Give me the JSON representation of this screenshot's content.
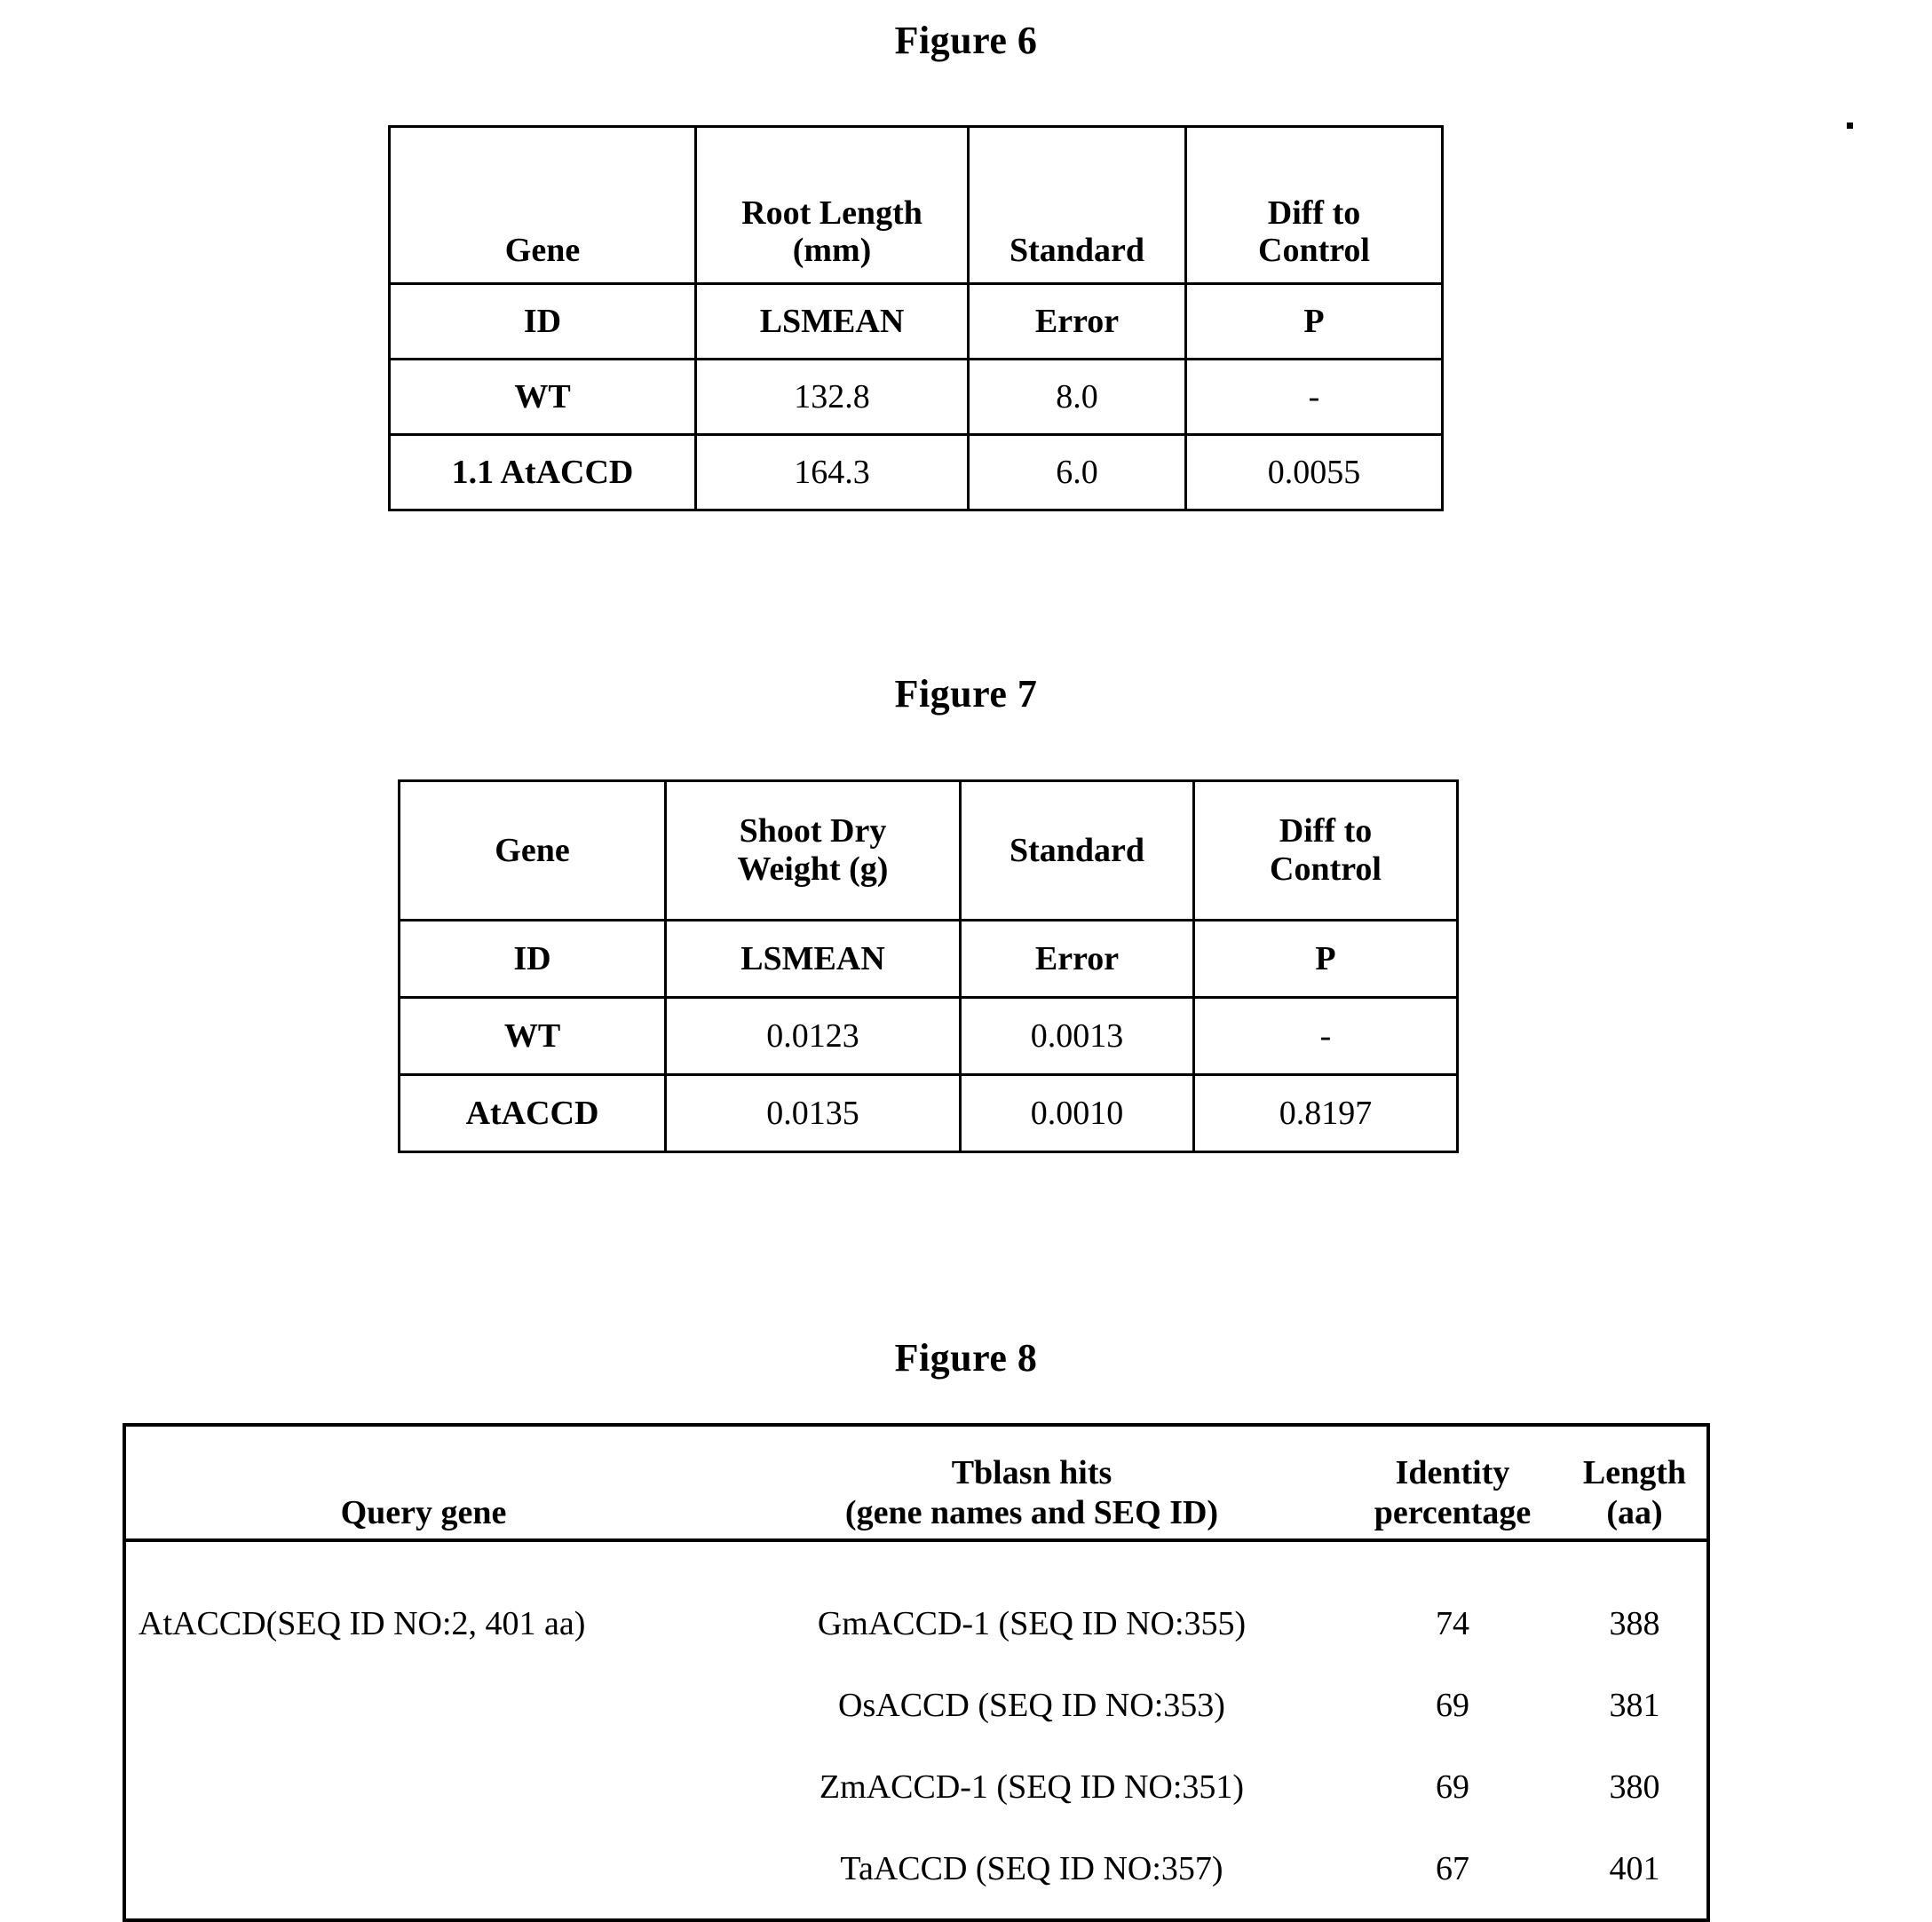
{
  "figures": [
    {
      "title": "Figure 6",
      "table": {
        "header_row_1": [
          "Gene",
          "Root Length\n(mm)",
          "Standard",
          "Diff to\nControl"
        ],
        "header_row_1_lines": [
          [
            "Gene"
          ],
          [
            "Root Length",
            "(mm)"
          ],
          [
            "Standard"
          ],
          [
            "Diff to",
            "Control"
          ]
        ],
        "header_row_2": [
          "ID",
          "LSMEAN",
          "Error",
          "P"
        ],
        "rows": [
          [
            "WT",
            "132.8",
            "8.0",
            "-"
          ],
          [
            "1.1 AtACCD",
            "164.3",
            "6.0",
            "0.0055"
          ]
        ]
      }
    },
    {
      "title": "Figure 7",
      "table": {
        "header_row_1_lines": [
          [
            "Gene"
          ],
          [
            "Shoot Dry",
            "Weight (g)"
          ],
          [
            "Standard"
          ],
          [
            "Diff to",
            "Control"
          ]
        ],
        "header_row_2": [
          "ID",
          "LSMEAN",
          "Error",
          "P"
        ],
        "rows": [
          [
            "WT",
            "0.0123",
            "0.0013",
            "-"
          ],
          [
            "AtACCD",
            "0.0135",
            "0.0010",
            "0.8197"
          ]
        ]
      }
    },
    {
      "title": "Figure 8",
      "table": {
        "header_lines": [
          [
            "Query gene"
          ],
          [
            "Tblasn hits",
            "(gene names and SEQ ID)"
          ],
          [
            "Identity",
            "percentage"
          ],
          [
            "Length",
            "(aa)"
          ]
        ],
        "rows": [
          [
            "AtACCD(SEQ ID NO:2, 401 aa)",
            "GmACCD-1 (SEQ ID NO:355)",
            "74",
            "388"
          ],
          [
            "",
            "OsACCD (SEQ ID NO:353)",
            "69",
            "381"
          ],
          [
            "",
            "ZmACCD-1 (SEQ ID NO:351)",
            "69",
            "380"
          ],
          [
            "",
            "TaACCD (SEQ ID NO:357)",
            "67",
            "401"
          ]
        ]
      }
    }
  ],
  "chart_data": [
    {
      "type": "table",
      "title": "Figure 6",
      "columns": [
        "Gene ID",
        "Root Length (mm) LSMEAN",
        "Standard Error",
        "Diff to Control P"
      ],
      "rows": [
        [
          "WT",
          132.8,
          8.0,
          null
        ],
        [
          "1.1 AtACCD",
          164.3,
          6.0,
          0.0055
        ]
      ]
    },
    {
      "type": "table",
      "title": "Figure 7",
      "columns": [
        "Gene ID",
        "Shoot Dry Weight (g) LSMEAN",
        "Standard Error",
        "Diff to Control P"
      ],
      "rows": [
        [
          "WT",
          0.0123,
          0.0013,
          null
        ],
        [
          "AtACCD",
          0.0135,
          0.001,
          0.8197
        ]
      ]
    },
    {
      "type": "table",
      "title": "Figure 8",
      "columns": [
        "Query gene",
        "Tblasn hits (gene names and SEQ ID)",
        "Identity percentage",
        "Length (aa)"
      ],
      "rows": [
        [
          "AtACCD(SEQ ID NO:2, 401 aa)",
          "GmACCD-1 (SEQ ID NO:355)",
          74,
          388
        ],
        [
          "",
          "OsACCD (SEQ ID NO:353)",
          69,
          381
        ],
        [
          "",
          "ZmACCD-1 (SEQ ID NO:351)",
          69,
          380
        ],
        [
          "",
          "TaACCD (SEQ ID NO:357)",
          67,
          401
        ]
      ]
    }
  ]
}
